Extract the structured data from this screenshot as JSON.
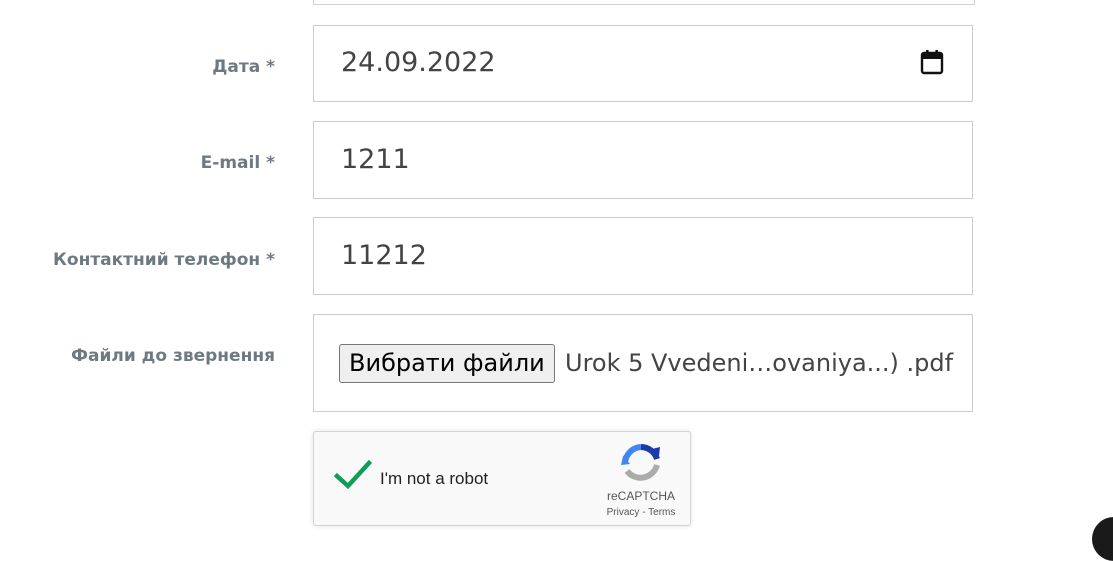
{
  "form": {
    "date": {
      "label": "Дата *",
      "value": "24.09.2022",
      "icon": "calendar-icon"
    },
    "email": {
      "label": "E-mail *",
      "value": "1211"
    },
    "phone": {
      "label": "Контактний телефон *",
      "value": "11212"
    },
    "files": {
      "label": "Файли до звернення",
      "button_label": "Вибрати файли",
      "file_name": "Urok 5 Vvedeni…ovaniya...) .pdf"
    },
    "previous_field": {
      "resize_grip": "〃"
    }
  },
  "recaptcha": {
    "text": "I'm not a robot",
    "checked": true,
    "brand": "reCAPTCHA",
    "privacy": "Privacy",
    "separator": "-",
    "terms": "Terms",
    "check_color": "#0f9d58"
  }
}
